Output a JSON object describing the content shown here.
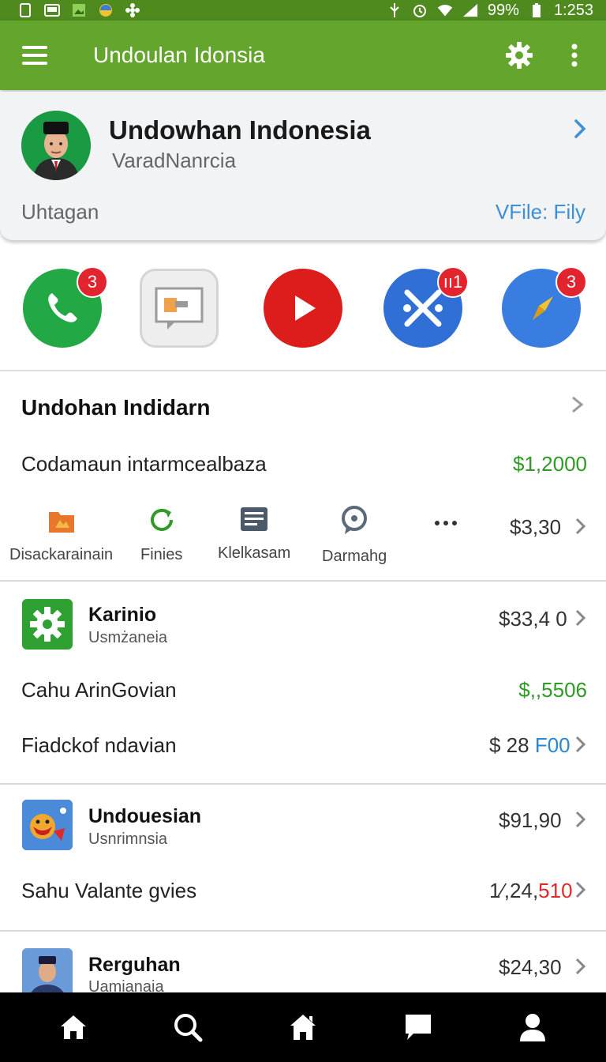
{
  "status_bar": {
    "battery": "99%",
    "time": "1:253"
  },
  "app_bar": {
    "title": "Undoulan Idonsia"
  },
  "profile": {
    "name": "Undowhan Indonesia",
    "subtitle": "VaradNanrcia",
    "tag": "Uhtagan",
    "link": "VFile: Fily"
  },
  "apps": [
    {
      "name": "phone",
      "badge": "3",
      "color": "#22a845"
    },
    {
      "name": "messages",
      "badge": "",
      "color": "#eeeeee"
    },
    {
      "name": "video",
      "badge": "",
      "color": "#dd1c1c"
    },
    {
      "name": "tools",
      "badge": "ıı1",
      "color": "#2f6fd6"
    },
    {
      "name": "navigator",
      "badge": "3",
      "color": "#3a7de0"
    }
  ],
  "summary": {
    "title": "Undohan Indidarn",
    "row_label": "Codamaun intarmcealbaza",
    "row_value": "$1,2000",
    "actions": [
      {
        "label": "Disackarainain",
        "icon": "folder-icon"
      },
      {
        "label": "Finies",
        "icon": "refresh-icon"
      },
      {
        "label": "Klelkasam",
        "icon": "document-icon"
      },
      {
        "label": "Darmahg",
        "icon": "chat-bubble-icon"
      }
    ],
    "more_value": "$3,30"
  },
  "item1": {
    "name": "Karinio",
    "sub": "Usmżaneia",
    "value": "$33,4 0",
    "row1_label": "Cahu ArinGovian",
    "row1_value": "$,,5506",
    "row2_label": "Fiadckof ndavian",
    "row2_value_a": "$ 28 ",
    "row2_value_b": "F00"
  },
  "item2": {
    "name": "Undouesian",
    "sub": "Usnrimnsia",
    "value": "$91,90",
    "row_label": "Sahu Valante gvies",
    "row_value_a": "1⁄,24,",
    "row_value_b": "510"
  },
  "item3": {
    "name": "Rerguhan",
    "sub": "Uamianaia",
    "value": "$24,30"
  },
  "colors": {
    "appbar": "#64a52d",
    "statusbar": "#4f8a1f",
    "accent_green": "#2f9a25",
    "accent_blue": "#2a86d6",
    "accent_red": "#e02828"
  }
}
